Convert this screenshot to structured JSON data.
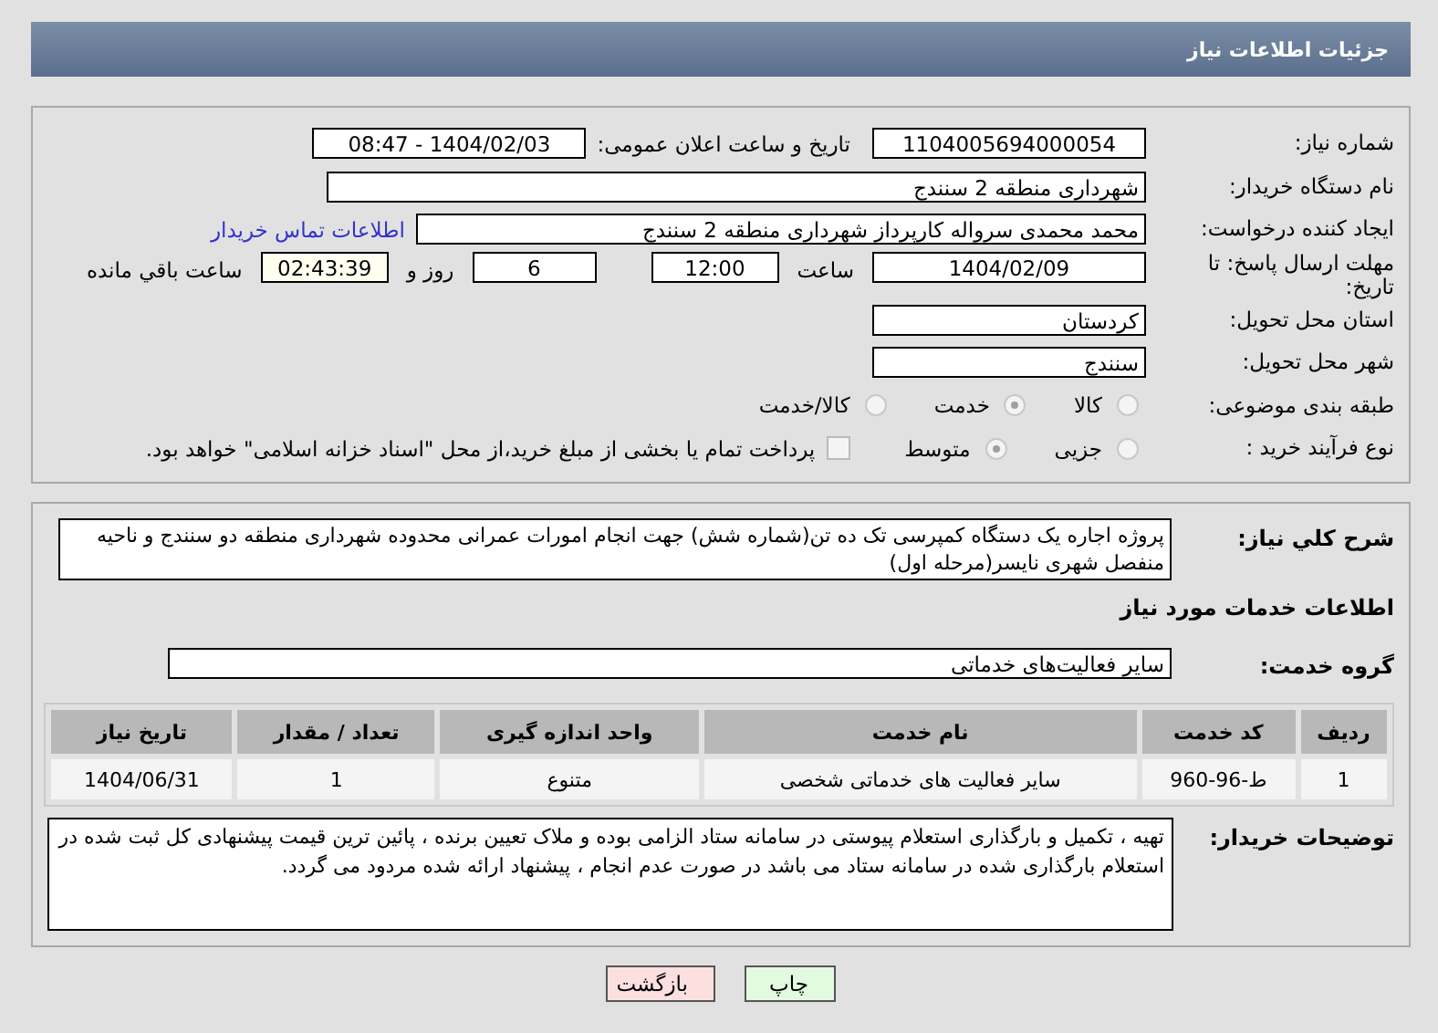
{
  "header": {
    "title": "جزئیات اطلاعات نیاز"
  },
  "need_info": {
    "need_number_label": "شماره نیاز:",
    "need_number": "1104005694000054",
    "announce_label": "تاریخ و ساعت اعلان عمومی:",
    "announce_value": "1404/02/03 - 08:47",
    "buyer_label": "نام دستگاه خریدار:",
    "buyer": "شهرداری منطقه 2 سنندج",
    "creator_label": "ایجاد کننده درخواست:",
    "creator": "محمد محمدی سرواله کارپرداز شهرداری منطقه 2 سنندج",
    "contact_link": "اطلاعات تماس خریدار",
    "deadline_label": "مهلت ارسال پاسخ: تا تاریخ:",
    "deadline_date": "1404/02/09",
    "time_label": "ساعت",
    "deadline_time": "12:00",
    "days": "6",
    "days_label": "روز و",
    "remaining": "02:43:39",
    "remaining_label": "ساعت باقي مانده",
    "province_label": "استان محل تحویل:",
    "province": "کردستان",
    "city_label": "شهر محل تحویل:",
    "city": "سنندج",
    "category_label": "طبقه بندی موضوعی:",
    "category_options": [
      {
        "label": "کالا",
        "selected": false
      },
      {
        "label": "خدمت",
        "selected": true
      },
      {
        "label": "کالا/خدمت",
        "selected": false
      }
    ],
    "process_label": "نوع فرآیند خرید :",
    "process_options": [
      {
        "label": "جزیی",
        "selected": false
      },
      {
        "label": "متوسط",
        "selected": true
      }
    ],
    "payment": {
      "checked": false,
      "label": "پرداخت تمام یا بخشی از مبلغ خرید،از محل \"اسناد خزانه اسلامی\" خواهد بود."
    }
  },
  "services": {
    "description_label": "شرح کلي نياز:",
    "description": "پروژه اجاره یک دستگاه کمپرسی تک ده تن(شماره شش) جهت انجام امورات عمرانی محدوده شهرداری منطقه دو سنندج و ناحیه منفصل شهری نایسر(مرحله اول)",
    "section_title": "اطلاعات خدمات مورد نیاز",
    "group_label": "گروه خدمت:",
    "group": "سایر فعالیت‌های خدماتی",
    "table": {
      "columns": [
        "ردیف",
        "کد خدمت",
        "نام خدمت",
        "واحد اندازه گیری",
        "تعداد / مقدار",
        "تاریخ نیاز"
      ],
      "rows": [
        [
          "1",
          "ط-96-960",
          "سایر فعالیت های خدماتی شخصی",
          "متنوع",
          "1",
          "1404/06/31"
        ]
      ]
    },
    "notes_label": "توضیحات خریدار:",
    "notes": "تهیه  ، تکمیل و بارگذاری استعلام پیوستی در سامانه ستاد الزامی بوده و ملاک تعیین برنده ، پائین ترین قیمت پیشنهادی کل ثبت شده در استعلام بارگذاری شده در سامانه ستاد می باشد در صورت عدم انجام ، پیشنهاد ارائه شده مردود می گردد."
  },
  "buttons": [
    {
      "label": "چاپ",
      "kind": "print"
    },
    {
      "label": "بازگشت",
      "kind": "back"
    }
  ]
}
